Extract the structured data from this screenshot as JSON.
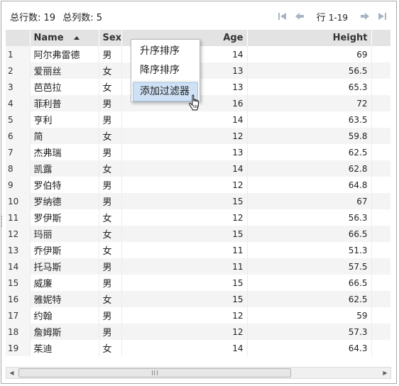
{
  "toolbar": {
    "total_rows_label": "总行数: 19",
    "total_cols_label": "总列数: 5",
    "row_range_prefix": "行",
    "row_range_value": "1-19"
  },
  "columns": [
    {
      "label": ""
    },
    {
      "label": "Name"
    },
    {
      "label": "Sex"
    },
    {
      "label": "Age"
    },
    {
      "label": "Height"
    }
  ],
  "rows": [
    {
      "n": "1",
      "name": "阿尔弗雷德",
      "sex": "男",
      "age": "14",
      "height": "69"
    },
    {
      "n": "2",
      "name": "爱丽丝",
      "sex": "女",
      "age": "13",
      "height": "56.5"
    },
    {
      "n": "3",
      "name": "芭芭拉",
      "sex": "女",
      "age": "13",
      "height": "65.3"
    },
    {
      "n": "4",
      "name": "菲利普",
      "sex": "男",
      "age": "16",
      "height": "72"
    },
    {
      "n": "5",
      "name": "亨利",
      "sex": "男",
      "age": "14",
      "height": "63.5"
    },
    {
      "n": "6",
      "name": "简",
      "sex": "女",
      "age": "12",
      "height": "59.8"
    },
    {
      "n": "7",
      "name": "杰弗瑞",
      "sex": "男",
      "age": "13",
      "height": "62.5"
    },
    {
      "n": "8",
      "name": "凯露",
      "sex": "女",
      "age": "14",
      "height": "62.8"
    },
    {
      "n": "9",
      "name": "罗伯特",
      "sex": "男",
      "age": "12",
      "height": "64.8"
    },
    {
      "n": "10",
      "name": "罗纳德",
      "sex": "男",
      "age": "15",
      "height": "67"
    },
    {
      "n": "11",
      "name": "罗伊斯",
      "sex": "女",
      "age": "12",
      "height": "56.3"
    },
    {
      "n": "12",
      "name": "玛丽",
      "sex": "女",
      "age": "15",
      "height": "66.5"
    },
    {
      "n": "13",
      "name": "乔伊斯",
      "sex": "女",
      "age": "11",
      "height": "51.3"
    },
    {
      "n": "14",
      "name": "托马斯",
      "sex": "男",
      "age": "11",
      "height": "57.5"
    },
    {
      "n": "15",
      "name": "威廉",
      "sex": "男",
      "age": "15",
      "height": "66.5"
    },
    {
      "n": "16",
      "name": "雅妮特",
      "sex": "女",
      "age": "15",
      "height": "62.5"
    },
    {
      "n": "17",
      "name": "约翰",
      "sex": "男",
      "age": "12",
      "height": "59"
    },
    {
      "n": "18",
      "name": "詹姆斯",
      "sex": "男",
      "age": "12",
      "height": "57.3"
    },
    {
      "n": "19",
      "name": "茱迪",
      "sex": "女",
      "age": "14",
      "height": "64.3"
    }
  ],
  "context_menu": {
    "sort_asc": "升序排序",
    "sort_desc": "降序排序",
    "add_filter": "添加过滤器"
  },
  "colors": {
    "header_bg": "#e3e3e3",
    "stripe": "#f4f4f4",
    "menu_highlight": "#cfe2f5",
    "pager_icon": "#a9b4c3"
  }
}
